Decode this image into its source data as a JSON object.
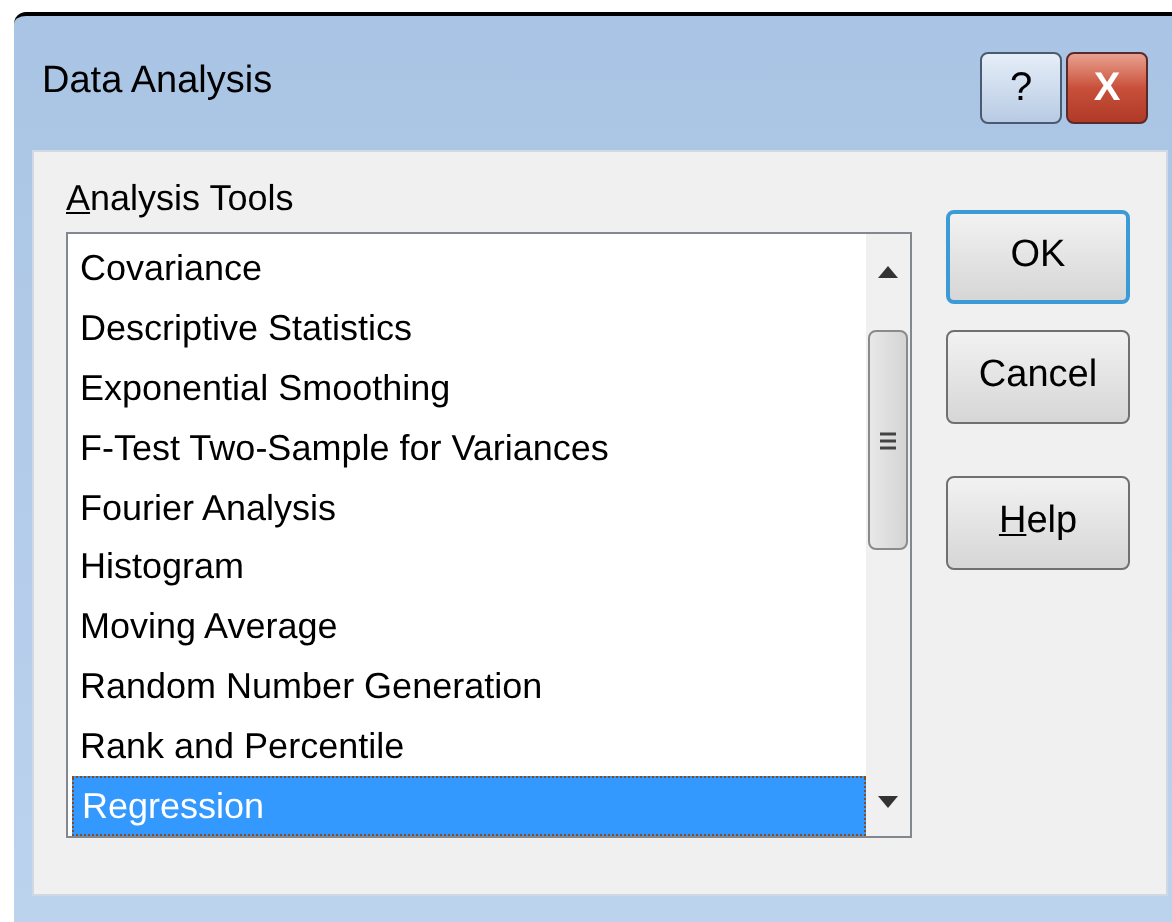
{
  "window": {
    "title": "Data Analysis"
  },
  "title_buttons": [
    {
      "kind": "help",
      "label": "?"
    },
    {
      "kind": "close",
      "label": "X"
    }
  ],
  "list_label": "Analysis Tools",
  "tools": [
    {
      "label": "Covariance",
      "selected": false
    },
    {
      "label": "Descriptive Statistics",
      "selected": false
    },
    {
      "label": "Exponential Smoothing",
      "selected": false
    },
    {
      "label": "F-Test Two-Sample for Variances",
      "selected": false
    },
    {
      "label": "Fourier Analysis",
      "selected": false
    },
    {
      "label": "Histogram",
      "selected": false
    },
    {
      "label": "Moving Average",
      "selected": false
    },
    {
      "label": "Random Number Generation",
      "selected": false
    },
    {
      "label": "Rank and Percentile",
      "selected": false
    },
    {
      "label": "Regression",
      "selected": true
    }
  ],
  "buttons": [
    {
      "label": "OK",
      "default": true,
      "mnemonic": false
    },
    {
      "label": "Cancel",
      "default": false,
      "mnemonic": false
    },
    {
      "label": "Help",
      "default": false,
      "mnemonic": true
    }
  ]
}
